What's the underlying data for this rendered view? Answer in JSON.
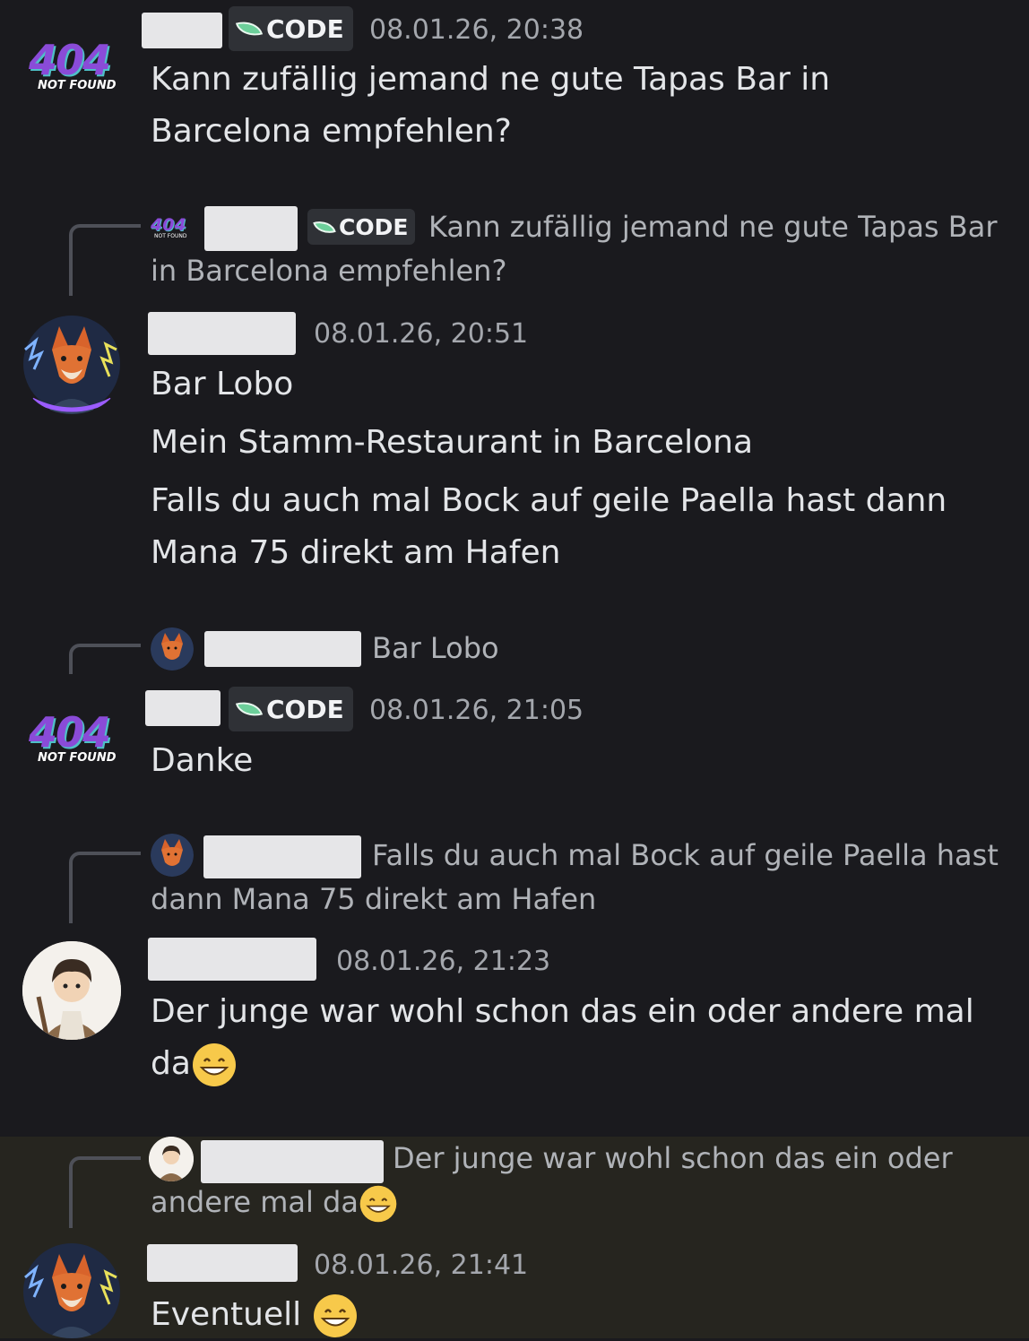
{
  "role_tag": "CODE",
  "avatar_404": {
    "number": "404",
    "subtitle": "NOT FOUND"
  },
  "messages": [
    {
      "timestamp": "08.01.26, 20:38",
      "lines": [
        "Kann zufällig jemand ne gute Tapas Bar in",
        "Barcelona empfehlen?"
      ]
    },
    {
      "reply": {
        "line1": "Kann zufällig jemand ne gute Tapas Bar",
        "line2": "in Barcelona empfehlen?"
      },
      "timestamp": "08.01.26, 20:51",
      "lines": [
        "Bar Lobo",
        "Mein Stamm-Restaurant in Barcelona",
        "Falls du auch mal Bock auf geile Paella hast dann",
        "Mana 75 direkt am Hafen"
      ]
    },
    {
      "reply": {
        "line1": "Bar Lobo"
      },
      "timestamp": "08.01.26, 21:05",
      "lines": [
        "Danke"
      ]
    },
    {
      "reply": {
        "line1": "Falls du auch mal Bock auf geile Paella hast",
        "line2": "dann Mana 75 direkt am Hafen"
      },
      "timestamp": "08.01.26, 21:23",
      "lines": [
        "Der junge war wohl schon das ein oder andere mal",
        "da"
      ]
    },
    {
      "reply": {
        "line1": "Der junge war wohl schon das ein oder",
        "line2": "andere mal da"
      },
      "timestamp": "08.01.26, 21:41",
      "lines": [
        "Eventuell"
      ]
    }
  ],
  "colors": {
    "background": "#1a1a1e",
    "highlight": "#26251f",
    "tag_leaf": "#6ccf9a",
    "avatar_404_purple": "#8a4bd8"
  }
}
